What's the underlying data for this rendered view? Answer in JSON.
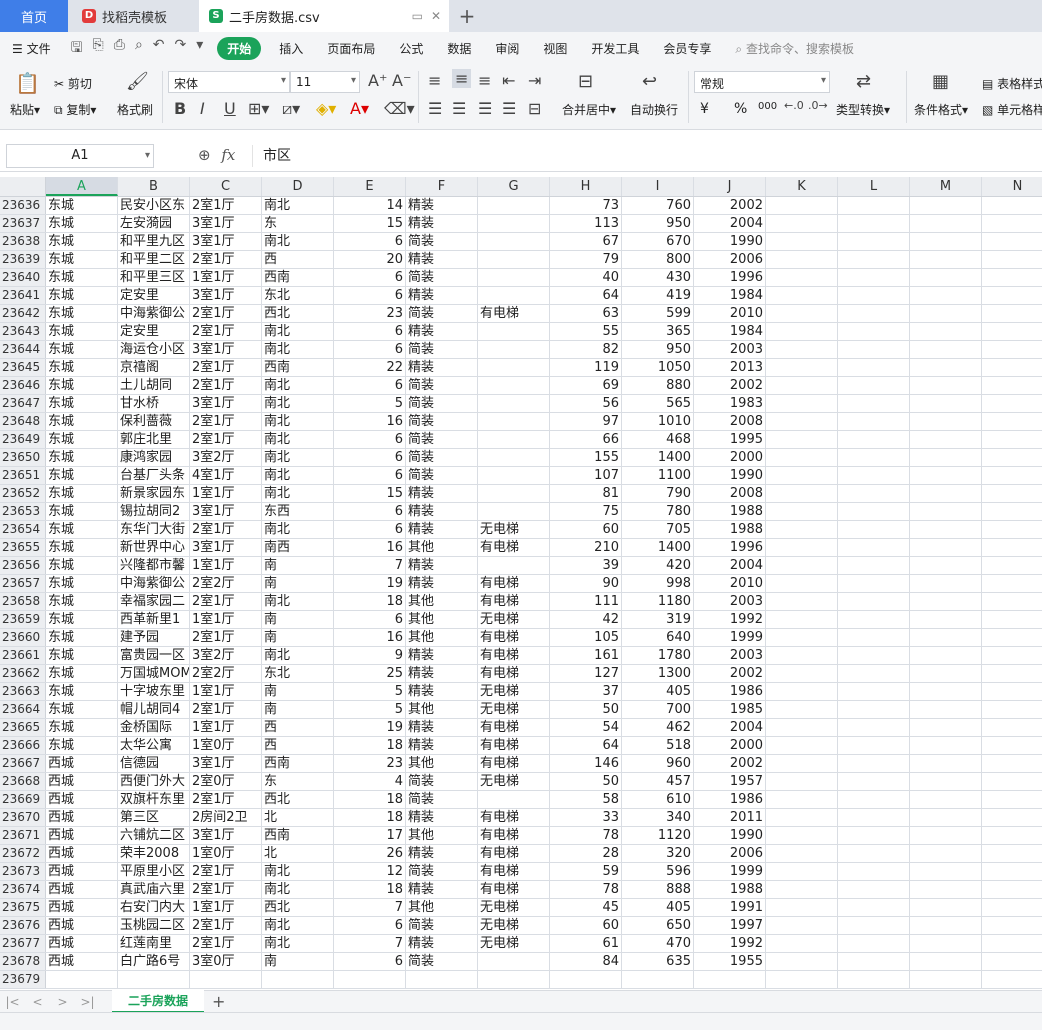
{
  "tabs": {
    "home": "首页",
    "template": "找稻壳模板",
    "file": "二手房数据.csv"
  },
  "menu": {
    "file": "文件",
    "items": [
      "开始",
      "插入",
      "页面布局",
      "公式",
      "数据",
      "审阅",
      "视图",
      "开发工具",
      "会员专享"
    ],
    "search": "查找命令、搜索模板"
  },
  "ribbon": {
    "paste": "粘贴",
    "cut": "剪切",
    "copy": "复制",
    "format_painter": "格式刷",
    "font_name": "宋体",
    "font_size": "11",
    "merge_center": "合并居中",
    "wrap_text": "自动换行",
    "number_format": "常规",
    "type_convert": "类型转换",
    "cond_format": "条件格式",
    "table_style": "表格样式",
    "cell_style": "单元格样式",
    "currency": "¥",
    "percent": "%",
    "thousands": "000"
  },
  "formula_bar": {
    "cell_ref": "A1",
    "fx": "fx",
    "value": "市区"
  },
  "columns": [
    "A",
    "B",
    "C",
    "D",
    "E",
    "F",
    "G",
    "H",
    "I",
    "J",
    "K",
    "L",
    "M",
    "N"
  ],
  "rows": [
    {
      "n": "23636",
      "c": [
        "东城",
        "民安小区东",
        "2室1厅",
        "南北",
        "14",
        "精装",
        "",
        "73",
        "760",
        "2002"
      ]
    },
    {
      "n": "23637",
      "c": [
        "东城",
        "左安漪园",
        "3室1厅",
        "东",
        "15",
        "精装",
        "",
        "113",
        "950",
        "2004"
      ]
    },
    {
      "n": "23638",
      "c": [
        "东城",
        "和平里九区",
        "3室1厅",
        "南北",
        "6",
        "简装",
        "",
        "67",
        "670",
        "1990"
      ]
    },
    {
      "n": "23639",
      "c": [
        "东城",
        "和平里二区",
        "2室1厅",
        "西",
        "20",
        "精装",
        "",
        "79",
        "800",
        "2006"
      ]
    },
    {
      "n": "23640",
      "c": [
        "东城",
        "和平里三区",
        "1室1厅",
        "西南",
        "6",
        "简装",
        "",
        "40",
        "430",
        "1996"
      ]
    },
    {
      "n": "23641",
      "c": [
        "东城",
        "定安里",
        "3室1厅",
        "东北",
        "6",
        "精装",
        "",
        "64",
        "419",
        "1984"
      ]
    },
    {
      "n": "23642",
      "c": [
        "东城",
        "中海紫御公",
        "2室1厅",
        "西北",
        "23",
        "简装",
        "有电梯",
        "63",
        "599",
        "2010"
      ]
    },
    {
      "n": "23643",
      "c": [
        "东城",
        "定安里",
        "2室1厅",
        "南北",
        "6",
        "精装",
        "",
        "55",
        "365",
        "1984"
      ]
    },
    {
      "n": "23644",
      "c": [
        "东城",
        "海运仓小区",
        "3室1厅",
        "南北",
        "6",
        "简装",
        "",
        "82",
        "950",
        "2003"
      ]
    },
    {
      "n": "23645",
      "c": [
        "东城",
        "京禧阁",
        "2室1厅",
        "西南",
        "22",
        "精装",
        "",
        "119",
        "1050",
        "2013"
      ]
    },
    {
      "n": "23646",
      "c": [
        "东城",
        "土儿胡同",
        "2室1厅",
        "南北",
        "6",
        "简装",
        "",
        "69",
        "880",
        "2002"
      ]
    },
    {
      "n": "23647",
      "c": [
        "东城",
        "甘水桥",
        "3室1厅",
        "南北",
        "5",
        "简装",
        "",
        "56",
        "565",
        "1983"
      ]
    },
    {
      "n": "23648",
      "c": [
        "东城",
        "保利蔷薇",
        "2室1厅",
        "南北",
        "16",
        "简装",
        "",
        "97",
        "1010",
        "2008"
      ]
    },
    {
      "n": "23649",
      "c": [
        "东城",
        "郭庄北里",
        "2室1厅",
        "南北",
        "6",
        "简装",
        "",
        "66",
        "468",
        "1995"
      ]
    },
    {
      "n": "23650",
      "c": [
        "东城",
        "康鸿家园",
        "3室2厅",
        "南北",
        "6",
        "简装",
        "",
        "155",
        "1400",
        "2000"
      ]
    },
    {
      "n": "23651",
      "c": [
        "东城",
        "台基厂头条",
        "4室1厅",
        "南北",
        "6",
        "简装",
        "",
        "107",
        "1100",
        "1990"
      ]
    },
    {
      "n": "23652",
      "c": [
        "东城",
        "新景家园东",
        "1室1厅",
        "南北",
        "15",
        "精装",
        "",
        "81",
        "790",
        "2008"
      ]
    },
    {
      "n": "23653",
      "c": [
        "东城",
        "锡拉胡同2",
        "3室1厅",
        "东西",
        "6",
        "精装",
        "",
        "75",
        "780",
        "1988"
      ]
    },
    {
      "n": "23654",
      "c": [
        "东城",
        "东华门大街",
        "2室1厅",
        "南北",
        "6",
        "精装",
        "无电梯",
        "60",
        "705",
        "1988"
      ]
    },
    {
      "n": "23655",
      "c": [
        "东城",
        "新世界中心",
        "3室1厅",
        "南西",
        "16",
        "其他",
        "有电梯",
        "210",
        "1400",
        "1996"
      ]
    },
    {
      "n": "23656",
      "c": [
        "东城",
        "兴隆都市馨",
        "1室1厅",
        "南",
        "7",
        "精装",
        "",
        "39",
        "420",
        "2004"
      ]
    },
    {
      "n": "23657",
      "c": [
        "东城",
        "中海紫御公",
        "2室2厅",
        "南",
        "19",
        "精装",
        "有电梯",
        "90",
        "998",
        "2010"
      ]
    },
    {
      "n": "23658",
      "c": [
        "东城",
        "幸福家园二",
        "2室1厅",
        "南北",
        "18",
        "其他",
        "有电梯",
        "111",
        "1180",
        "2003"
      ]
    },
    {
      "n": "23659",
      "c": [
        "东城",
        "西革新里1",
        "1室1厅",
        "南",
        "6",
        "其他",
        "无电梯",
        "42",
        "319",
        "1992"
      ]
    },
    {
      "n": "23660",
      "c": [
        "东城",
        "建予园",
        "2室1厅",
        "南",
        "16",
        "其他",
        "有电梯",
        "105",
        "640",
        "1999"
      ]
    },
    {
      "n": "23661",
      "c": [
        "东城",
        "富贵园一区",
        "3室2厅",
        "南北",
        "9",
        "精装",
        "有电梯",
        "161",
        "1780",
        "2003"
      ]
    },
    {
      "n": "23662",
      "c": [
        "东城",
        "万国城MOMA",
        "2室2厅",
        "东北",
        "25",
        "精装",
        "有电梯",
        "127",
        "1300",
        "2002"
      ]
    },
    {
      "n": "23663",
      "c": [
        "东城",
        "十字坡东里",
        "1室1厅",
        "南",
        "5",
        "精装",
        "无电梯",
        "37",
        "405",
        "1986"
      ]
    },
    {
      "n": "23664",
      "c": [
        "东城",
        "帽儿胡同4",
        "2室1厅",
        "南",
        "5",
        "其他",
        "无电梯",
        "50",
        "700",
        "1985"
      ]
    },
    {
      "n": "23665",
      "c": [
        "东城",
        "金桥国际",
        "1室1厅",
        "西",
        "19",
        "精装",
        "有电梯",
        "54",
        "462",
        "2004"
      ]
    },
    {
      "n": "23666",
      "c": [
        "东城",
        "太华公寓",
        "1室0厅",
        "西",
        "18",
        "精装",
        "有电梯",
        "64",
        "518",
        "2000"
      ]
    },
    {
      "n": "23667",
      "c": [
        "西城",
        "信德园",
        "3室1厅",
        "西南",
        "23",
        "其他",
        "有电梯",
        "146",
        "960",
        "2002"
      ]
    },
    {
      "n": "23668",
      "c": [
        "西城",
        "西便门外大",
        "2室0厅",
        "东",
        "4",
        "简装",
        "无电梯",
        "50",
        "457",
        "1957"
      ]
    },
    {
      "n": "23669",
      "c": [
        "西城",
        "双旗杆东里",
        "2室1厅",
        "西北",
        "18",
        "简装",
        "",
        "58",
        "610",
        "1986"
      ]
    },
    {
      "n": "23670",
      "c": [
        "西城",
        "第三区",
        "2房间2卫",
        "北",
        "18",
        "精装",
        "有电梯",
        "33",
        "340",
        "2011"
      ]
    },
    {
      "n": "23671",
      "c": [
        "西城",
        "六铺炕二区",
        "3室1厅",
        "西南",
        "17",
        "其他",
        "有电梯",
        "78",
        "1120",
        "1990"
      ]
    },
    {
      "n": "23672",
      "c": [
        "西城",
        "荣丰2008",
        "1室0厅",
        "北",
        "26",
        "精装",
        "有电梯",
        "28",
        "320",
        "2006"
      ]
    },
    {
      "n": "23673",
      "c": [
        "西城",
        "平原里小区",
        "2室1厅",
        "南北",
        "12",
        "简装",
        "有电梯",
        "59",
        "596",
        "1999"
      ]
    },
    {
      "n": "23674",
      "c": [
        "西城",
        "真武庙六里",
        "2室1厅",
        "南北",
        "18",
        "精装",
        "有电梯",
        "78",
        "888",
        "1988"
      ]
    },
    {
      "n": "23675",
      "c": [
        "西城",
        "右安门内大",
        "1室1厅",
        "西北",
        "7",
        "其他",
        "无电梯",
        "45",
        "405",
        "1991"
      ]
    },
    {
      "n": "23676",
      "c": [
        "西城",
        "玉桃园二区",
        "2室1厅",
        "南北",
        "6",
        "简装",
        "无电梯",
        "60",
        "650",
        "1997"
      ]
    },
    {
      "n": "23677",
      "c": [
        "西城",
        "红莲南里",
        "2室1厅",
        "南北",
        "7",
        "精装",
        "无电梯",
        "61",
        "470",
        "1992"
      ]
    },
    {
      "n": "23678",
      "c": [
        "西城",
        "白广路6号",
        "3室0厅",
        "南",
        "6",
        "简装",
        "",
        "84",
        "635",
        "1955"
      ]
    },
    {
      "n": "23679",
      "c": [
        "",
        "",
        "",
        "",
        "",
        "",
        "",
        "",
        "",
        ""
      ]
    }
  ],
  "sheet_tab": "二手房数据"
}
